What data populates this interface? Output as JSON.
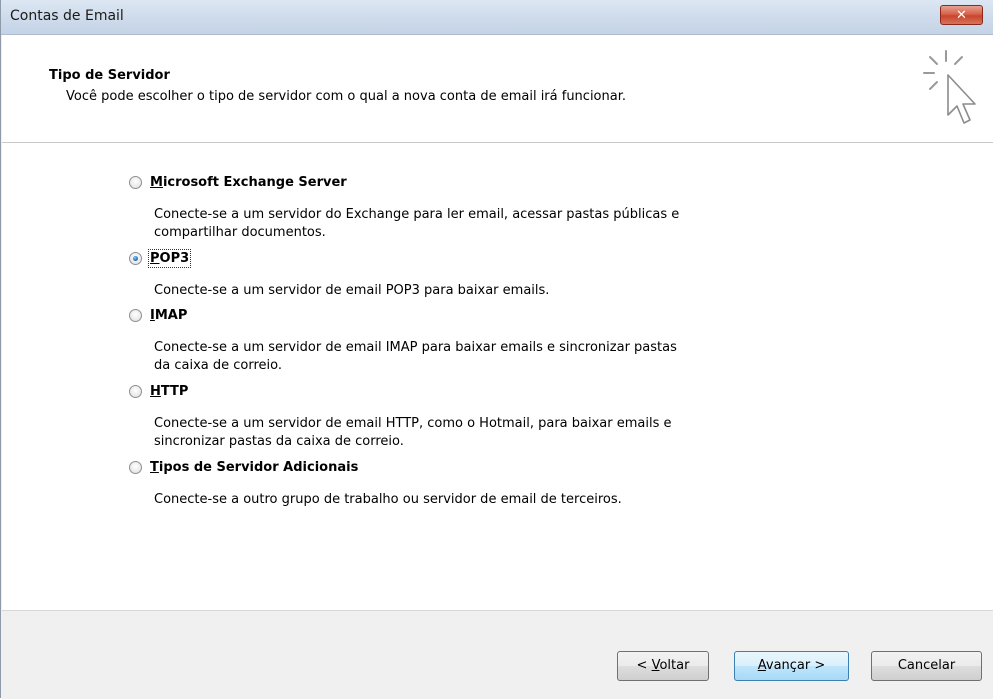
{
  "window": {
    "title": "Contas de Email",
    "close_glyph": "✕"
  },
  "header": {
    "title": "Tipo de Servidor",
    "description": "Você pode escolher o tipo de servidor com o qual a nova conta de email irá funcionar.",
    "icon": "wizard-cursor-icon"
  },
  "options": [
    {
      "mnemonic": "M",
      "label_rest": "icrosoft Exchange Server",
      "description_lines": [
        "Conecte-se a um servidor do Exchange para ler email, acessar pastas públicas e",
        "compartilhar documentos."
      ],
      "selected": false
    },
    {
      "mnemonic": "P",
      "label_rest": "OP3",
      "description_lines": [
        "Conecte-se a um servidor de email POP3 para baixar emails."
      ],
      "selected": true
    },
    {
      "mnemonic": "I",
      "label_rest": "MAP",
      "description_lines": [
        "Conecte-se a um servidor de email IMAP para baixar emails e sincronizar pastas",
        "da caixa de correio."
      ],
      "selected": false
    },
    {
      "mnemonic": "H",
      "label_rest": "TTP",
      "description_lines": [
        "Conecte-se a um servidor de email HTTP, como o Hotmail, para baixar emails e",
        "sincronizar pastas da caixa de correio."
      ],
      "selected": false
    },
    {
      "mnemonic": "T",
      "label_rest": "ipos de Servidor Adicionais",
      "description_lines": [
        "Conecte-se a outro grupo de trabalho ou servidor de email de terceiros."
      ],
      "selected": false
    }
  ],
  "buttons": {
    "back": {
      "prefix": "< ",
      "mnemonic": "V",
      "rest": "oltar"
    },
    "next": {
      "mnemonic": "A",
      "rest": "vançar >"
    },
    "cancel": {
      "label": "Cancelar"
    }
  },
  "colors": {
    "accent": "#3c7fb1",
    "close": "#c8452b"
  }
}
